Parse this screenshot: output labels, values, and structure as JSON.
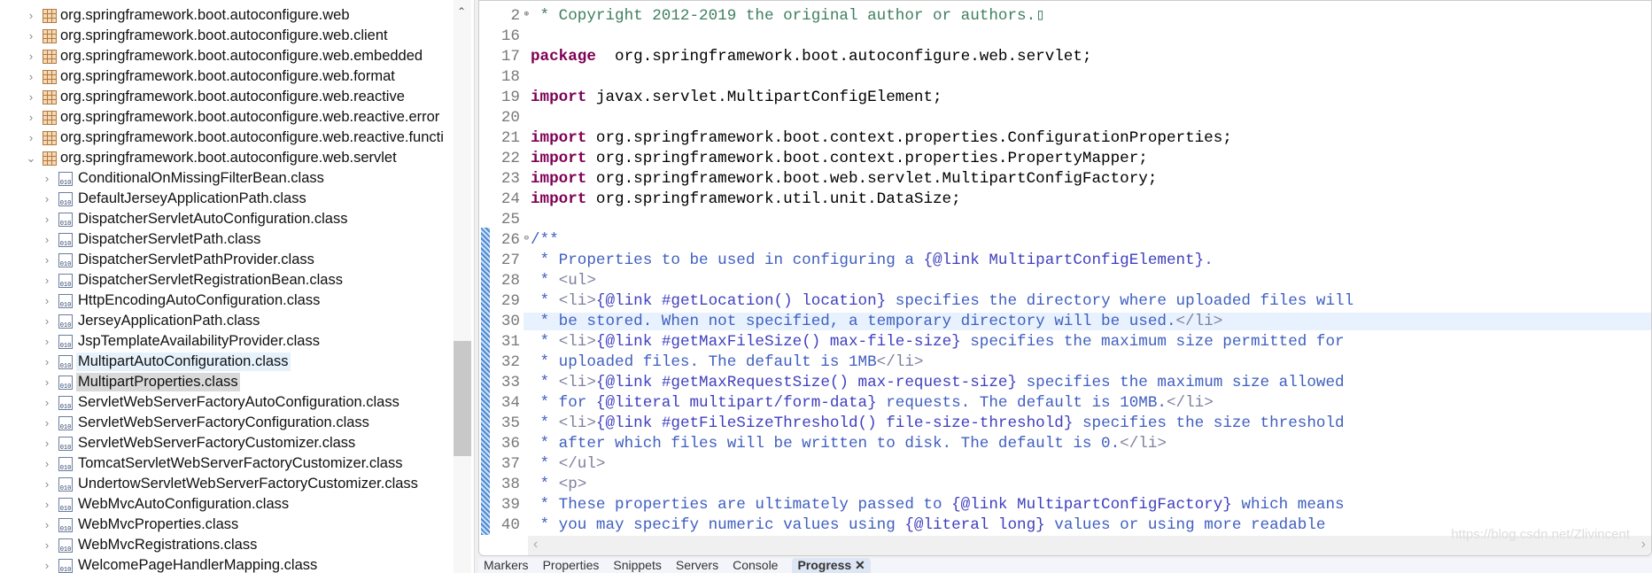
{
  "tree": {
    "packages": [
      "org.springframework.boot.autoconfigure.web",
      "org.springframework.boot.autoconfigure.web.client",
      "org.springframework.boot.autoconfigure.web.embedded",
      "org.springframework.boot.autoconfigure.web.format",
      "org.springframework.boot.autoconfigure.web.reactive",
      "org.springframework.boot.autoconfigure.web.reactive.error",
      "org.springframework.boot.autoconfigure.web.reactive.functi",
      "org.springframework.boot.autoconfigure.web.servlet"
    ],
    "classes": [
      "ConditionalOnMissingFilterBean.class",
      "DefaultJerseyApplicationPath.class",
      "DispatcherServletAutoConfiguration.class",
      "DispatcherServletPath.class",
      "DispatcherServletPathProvider.class",
      "DispatcherServletRegistrationBean.class",
      "HttpEncodingAutoConfiguration.class",
      "JerseyApplicationPath.class",
      "JspTemplateAvailabilityProvider.class",
      "MultipartAutoConfiguration.class",
      "MultipartProperties.class",
      "ServletWebServerFactoryAutoConfiguration.class",
      "ServletWebServerFactoryConfiguration.class",
      "ServletWebServerFactoryCustomizer.class",
      "TomcatServletWebServerFactoryCustomizer.class",
      "UndertowServletWebServerFactoryCustomizer.class",
      "WebMvcAutoConfiguration.class",
      "WebMvcProperties.class",
      "WebMvcRegistrations.class",
      "WelcomePageHandlerMapping.class"
    ],
    "hovered": "MultipartAutoConfiguration.class",
    "selected": "MultipartProperties.class"
  },
  "editor": {
    "lines": [
      {
        "n": "2",
        "parts": [
          [
            "cm",
            " * Copyright 2012-2019 the original author or authors.▯"
          ]
        ],
        "fold": "⊕"
      },
      {
        "n": "16",
        "parts": []
      },
      {
        "n": "17",
        "parts": [
          [
            "kw",
            "package"
          ],
          [
            "",
            "  org.springframework.boot.autoconfigure.web.servlet;"
          ]
        ]
      },
      {
        "n": "18",
        "parts": []
      },
      {
        "n": "19",
        "parts": [
          [
            "kw",
            "import"
          ],
          [
            "",
            " javax.servlet.MultipartConfigElement;"
          ]
        ]
      },
      {
        "n": "20",
        "parts": []
      },
      {
        "n": "21",
        "parts": [
          [
            "kw",
            "import"
          ],
          [
            "",
            " org.springframework.boot.context.properties.ConfigurationProperties;"
          ]
        ]
      },
      {
        "n": "22",
        "parts": [
          [
            "kw",
            "import"
          ],
          [
            "",
            " org.springframework.boot.context.properties.PropertyMapper;"
          ]
        ]
      },
      {
        "n": "23",
        "parts": [
          [
            "kw",
            "import"
          ],
          [
            "",
            " org.springframework.boot.web.servlet.MultipartConfigFactory;"
          ]
        ]
      },
      {
        "n": "24",
        "parts": [
          [
            "kw",
            "import"
          ],
          [
            "",
            " org.springframework.util.unit.DataSize;"
          ]
        ]
      },
      {
        "n": "25",
        "parts": []
      },
      {
        "n": "26",
        "parts": [
          [
            "jd",
            "/**"
          ]
        ],
        "fold": "⊖"
      },
      {
        "n": "27",
        "parts": [
          [
            "jd",
            " * Properties to be used in configuring a "
          ],
          [
            "lk",
            "{@link MultipartConfigElement}"
          ],
          [
            "jd",
            "."
          ]
        ]
      },
      {
        "n": "28",
        "parts": [
          [
            "jd",
            " * "
          ],
          [
            "tag",
            "<ul>"
          ]
        ]
      },
      {
        "n": "29",
        "parts": [
          [
            "jd",
            " * "
          ],
          [
            "tag",
            "<li>"
          ],
          [
            "lk",
            "{@link #getLocation() location}"
          ],
          [
            "jd",
            " specifies the directory where uploaded files will"
          ]
        ]
      },
      {
        "n": "30",
        "parts": [
          [
            "jd",
            " * be stored. When not specified, a temporary directory will be used."
          ],
          [
            "tag",
            "</li>"
          ]
        ],
        "current": true
      },
      {
        "n": "31",
        "parts": [
          [
            "jd",
            " * "
          ],
          [
            "tag",
            "<li>"
          ],
          [
            "lk",
            "{@link #getMaxFileSize() max-file-size}"
          ],
          [
            "jd",
            " specifies the maximum size permitted for"
          ]
        ]
      },
      {
        "n": "32",
        "parts": [
          [
            "jd",
            " * uploaded files. The default is 1MB"
          ],
          [
            "tag",
            "</li>"
          ]
        ]
      },
      {
        "n": "33",
        "parts": [
          [
            "jd",
            " * "
          ],
          [
            "tag",
            "<li>"
          ],
          [
            "lk",
            "{@link #getMaxRequestSize() max-request-size}"
          ],
          [
            "jd",
            " specifies the maximum size allowed"
          ]
        ]
      },
      {
        "n": "34",
        "parts": [
          [
            "jd",
            " * for "
          ],
          [
            "lk",
            "{@literal multipart/form-data}"
          ],
          [
            "jd",
            " requests. The default is 10MB."
          ],
          [
            "tag",
            "</li>"
          ]
        ]
      },
      {
        "n": "35",
        "parts": [
          [
            "jd",
            " * "
          ],
          [
            "tag",
            "<li>"
          ],
          [
            "lk",
            "{@link #getFileSizeThreshold() file-size-threshold}"
          ],
          [
            "jd",
            " specifies the size threshold"
          ]
        ]
      },
      {
        "n": "36",
        "parts": [
          [
            "jd",
            " * after which files will be written to disk. The default is 0."
          ],
          [
            "tag",
            "</li>"
          ]
        ]
      },
      {
        "n": "37",
        "parts": [
          [
            "jd",
            " * "
          ],
          [
            "tag",
            "</ul>"
          ]
        ]
      },
      {
        "n": "38",
        "parts": [
          [
            "jd",
            " * "
          ],
          [
            "tag",
            "<p>"
          ]
        ]
      },
      {
        "n": "39",
        "parts": [
          [
            "jd",
            " * These properties are ultimately passed to "
          ],
          [
            "lk",
            "{@link MultipartConfigFactory}"
          ],
          [
            "jd",
            " which means"
          ]
        ]
      },
      {
        "n": "40",
        "parts": [
          [
            "jd",
            " * you may specify numeric values using "
          ],
          [
            "lk",
            "{@literal long}"
          ],
          [
            "jd",
            " values or using more readable"
          ]
        ]
      }
    ]
  },
  "bottom_tabs": [
    "Markers",
    "Properties",
    "Snippets",
    "Servers",
    "Console",
    "Progress ✕"
  ],
  "active_tab": "Progress ✕",
  "watermark": "https://blog.csdn.net/Zlivincent"
}
